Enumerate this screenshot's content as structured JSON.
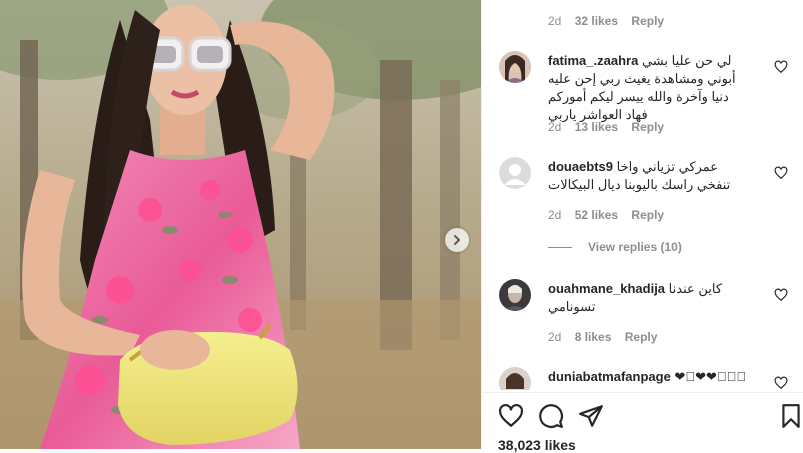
{
  "comments": [
    {
      "time": "2d",
      "likes": "32 likes",
      "reply": "Reply"
    },
    {
      "user": "fatima_.zaahra",
      "text": "لي حن عليا بشي أبوني ومشاهدة يغيث ربي إحن عليه دنيا وآخرة والله ييسر ليكم أموركم فهاد العواشر ياربي",
      "time": "2d",
      "likes": "13 likes",
      "reply": "Reply"
    },
    {
      "user": "douaebts9",
      "text": "عمركي تزياني واخا تنفخي راسك باليوبنا ديال البيكالات",
      "time": "2d",
      "likes": "52 likes",
      "reply": "Reply",
      "view_replies": "View replies (10)"
    },
    {
      "user": "ouahmane_khadija",
      "text": "كاين عندنا تسونامي",
      "time": "2d",
      "likes": "8 likes",
      "reply": "Reply"
    },
    {
      "user": "duniabatmafanpage",
      "text": "❤􏰀❤❤􏰀􏰀􏰀"
    }
  ],
  "footer": {
    "likes": "38,023 likes"
  },
  "icons": {
    "next": "chevron-right-icon",
    "like": "heart-outline-icon",
    "comment": "speech-bubble-icon",
    "share": "paper-plane-icon",
    "save": "bookmark-icon"
  },
  "colors": {
    "text": "#262626",
    "muted": "#8e8e8e",
    "border": "#efefef"
  }
}
